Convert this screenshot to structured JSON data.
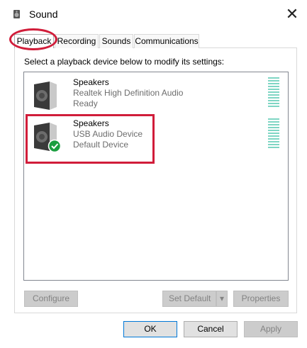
{
  "window": {
    "title": "Sound"
  },
  "tabs": [
    {
      "label": "Playback"
    },
    {
      "label": "Recording"
    },
    {
      "label": "Sounds"
    },
    {
      "label": "Communications"
    }
  ],
  "instructions": "Select a playback device below to modify its settings:",
  "devices": [
    {
      "name": "Speakers",
      "driver": "Realtek High Definition Audio",
      "status": "Ready"
    },
    {
      "name": "Speakers",
      "driver": "USB Audio Device",
      "status": "Default Device"
    }
  ],
  "buttons": {
    "configure": "Configure",
    "set_default": "Set Default",
    "properties": "Properties",
    "ok": "OK",
    "cancel": "Cancel",
    "apply": "Apply"
  },
  "colors": {
    "highlight": "#d11d3a",
    "default_check": "#1a9e3f",
    "meter": "#7fd6c4"
  },
  "icons": [
    "speaker-icon",
    "close-icon",
    "checkmark-icon",
    "chevron-down-icon"
  ]
}
